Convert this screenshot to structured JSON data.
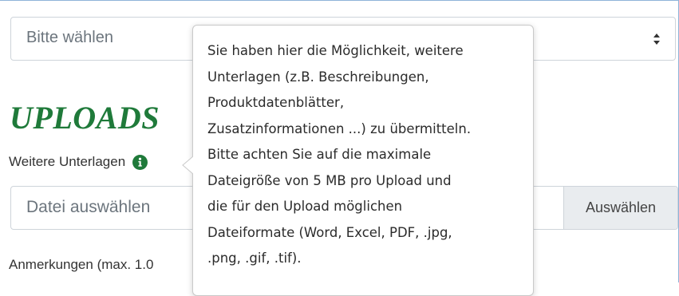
{
  "select": {
    "placeholder": "Bitte wählen"
  },
  "uploads": {
    "heading": "UPLOADS",
    "label": "Weitere Unterlagen",
    "file_placeholder": "Datei auswählen",
    "browse_label": "Auswählen"
  },
  "notes": {
    "label": "Anmerkungen (max. 1.0"
  },
  "tooltip": {
    "lines": [
      "Sie haben hier die Möglichkeit, weitere",
      "Unterlagen (z.B. Beschreibungen,",
      "Produktdatenblätter,",
      "Zusatzinformationen ...) zu übermitteln.",
      "Bitte achten Sie auf die maximale",
      "Dateigröße von 5 MB pro Upload und",
      "die für den Upload möglichen",
      "Dateiformate (Word, Excel, PDF, .jpg,",
      ".png, .gif, .tif)."
    ]
  },
  "icons": {
    "info": "info-icon",
    "select_arrows": "sort-arrows-icon"
  },
  "colors": {
    "heading_green": "#1f7a3a",
    "placeholder_gray": "#6c757d",
    "button_bg": "#e9ecef",
    "border": "#ced4da"
  }
}
